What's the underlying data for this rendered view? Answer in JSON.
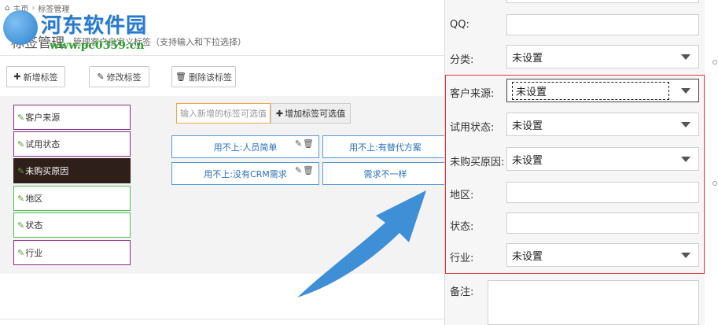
{
  "breadcrumb": {
    "home": "主页",
    "separator": "›",
    "current": "标签管理"
  },
  "watermark": {
    "name": "河东软件园",
    "url": "www.pc0359.cn"
  },
  "page": {
    "title": "标签管理",
    "description": "管理客户自定义标签（支持输入和下拉选择）"
  },
  "toolbar": {
    "add_label": "新增标签",
    "edit_label": "修改标签",
    "delete_label": "删除该标签"
  },
  "categories": [
    {
      "label": "客户来源"
    },
    {
      "label": "试用状态"
    },
    {
      "label": "未购买原因"
    },
    {
      "label": "地区"
    },
    {
      "label": "状态"
    },
    {
      "label": "行业"
    }
  ],
  "new_value": {
    "placeholder": "输入新增的标签可选值",
    "add_button": "增加标签可选值"
  },
  "values": [
    {
      "label": "用不上:人员简单"
    },
    {
      "label": "用不上:有替代方案"
    },
    {
      "label": "用不上:没有CRM需求"
    },
    {
      "label": "需求不一样"
    }
  ],
  "form": {
    "qq_label": "QQ:",
    "category_label": "分类:",
    "category_value": "未设置",
    "source_label": "客户来源:",
    "source_value": "未设置",
    "trial_label": "试用状态:",
    "trial_value": "未设置",
    "reason_label": "未购买原因:",
    "reason_value": "未设置",
    "region_label": "地区:",
    "status_label": "状态:",
    "industry_label": "行业:",
    "industry_value": "未设置",
    "notes_label": "备注:"
  },
  "colors": {
    "highlight_border": "#e0373a",
    "arrow": "#3f8fd6",
    "active_category": "#2f1f1a"
  }
}
